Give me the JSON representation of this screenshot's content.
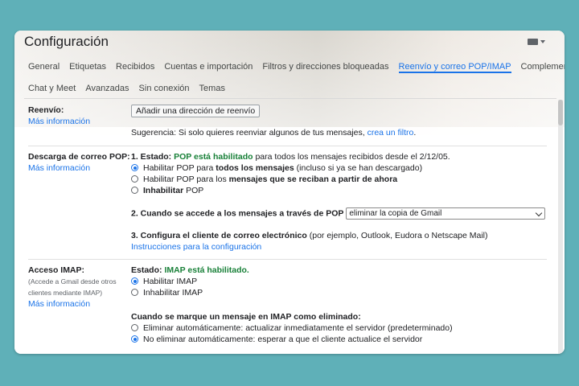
{
  "title": "Configuración",
  "tabs_row1": [
    "General",
    "Etiquetas",
    "Recibidos",
    "Cuentas e importación",
    "Filtros y direcciones bloqueadas",
    "Reenvío y correo POP/IMAP",
    "Complementos"
  ],
  "tabs_row2": [
    "Chat y Meet",
    "Avanzadas",
    "Sin conexión",
    "Temas"
  ],
  "active_tab": "Reenvío y correo POP/IMAP",
  "forwarding": {
    "label": "Reenvío:",
    "more_info": "Más información",
    "button": "Añadir una dirección de reenvío",
    "tip_text": "Sugerencia: Si solo quieres reenviar algunos de tus mensajes,",
    "tip_link": "crea un filtro",
    "tip_end": "."
  },
  "pop": {
    "label": "Descarga de correo POP:",
    "more_info": "Más información",
    "status_prefix": "1. Estado:",
    "status_value": "POP está habilitado",
    "status_suffix": "para todos los mensajes recibidos desde el 2/12/05.",
    "option1_a": "Habilitar POP para",
    "option1_b": "todos los mensajes",
    "option1_c": "(incluso si ya se han descargado)",
    "option2_a": "Habilitar POP para los",
    "option2_b": "mensajes que se reciban a partir de ahora",
    "option3_a": "Inhabilitar",
    "option3_b": "POP",
    "step2": "2. Cuando se accede a los mensajes a través de POP",
    "step2_select": "eliminar la copia de Gmail",
    "step3_a": "3. Configura el cliente de correo electrónico",
    "step3_b": "(por ejemplo, Outlook, Eudora o Netscape Mail)",
    "instructions_link": "Instrucciones para la configuración"
  },
  "imap": {
    "label": "Acceso IMAP:",
    "sub1": "(Accede a Gmail desde otros",
    "sub2": "clientes mediante IMAP)",
    "more_info": "Más información",
    "status_prefix": "Estado:",
    "status_value": "IMAP está habilitado.",
    "enable": "Habilitar IMAP",
    "disable": "Inhabilitar IMAP",
    "deleted_heading": "Cuando se marque un mensaje en IMAP como eliminado:",
    "auto_delete": "Eliminar automáticamente: actualizar inmediatamente el servidor (predeterminado)",
    "no_auto_delete": "No eliminar automáticamente: esperar a que el cliente actualice el servidor"
  },
  "colors": {
    "accent": "#1a73e8",
    "green": "#188038",
    "background": "#5fb0b8"
  }
}
